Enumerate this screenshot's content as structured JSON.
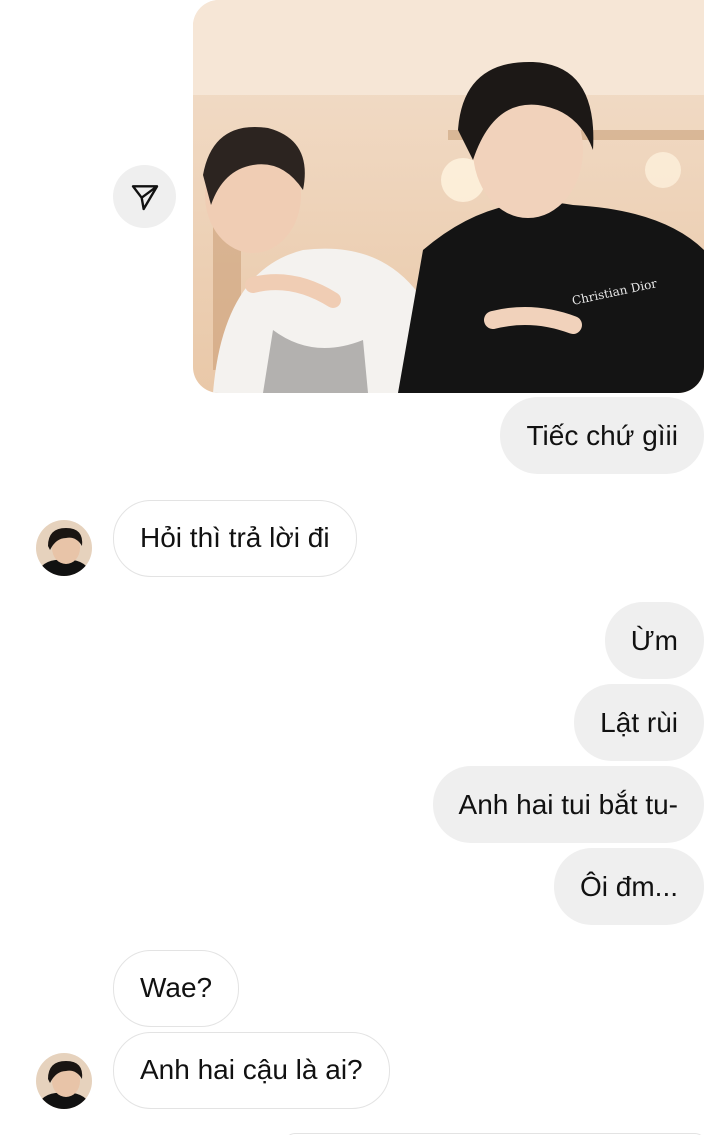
{
  "thread": {
    "shared_image": {
      "alt": "",
      "share_icon": "send-icon"
    },
    "messages": [
      {
        "id": "m1",
        "side": "outgoing",
        "text": "Tiếc chứ gìii"
      },
      {
        "id": "m2",
        "side": "incoming",
        "text": "Hỏi thì trả lời đi",
        "avatar": true
      },
      {
        "id": "m3",
        "side": "outgoing",
        "text": "Ừm"
      },
      {
        "id": "m4",
        "side": "outgoing",
        "text": "Lật rùi"
      },
      {
        "id": "m5",
        "side": "outgoing",
        "text": "Anh hai tui bắt tu-"
      },
      {
        "id": "m6",
        "side": "outgoing",
        "text": "Ôi đm..."
      },
      {
        "id": "m7",
        "side": "incoming",
        "text": "Wae?"
      },
      {
        "id": "m8",
        "side": "incoming",
        "text": "Anh hai cậu là ai?",
        "avatar": true
      }
    ]
  },
  "colors": {
    "outgoing_bubble": "#efefef",
    "incoming_bubble": "#ffffff",
    "incoming_border": "#e3e3e3",
    "text": "#111111"
  }
}
